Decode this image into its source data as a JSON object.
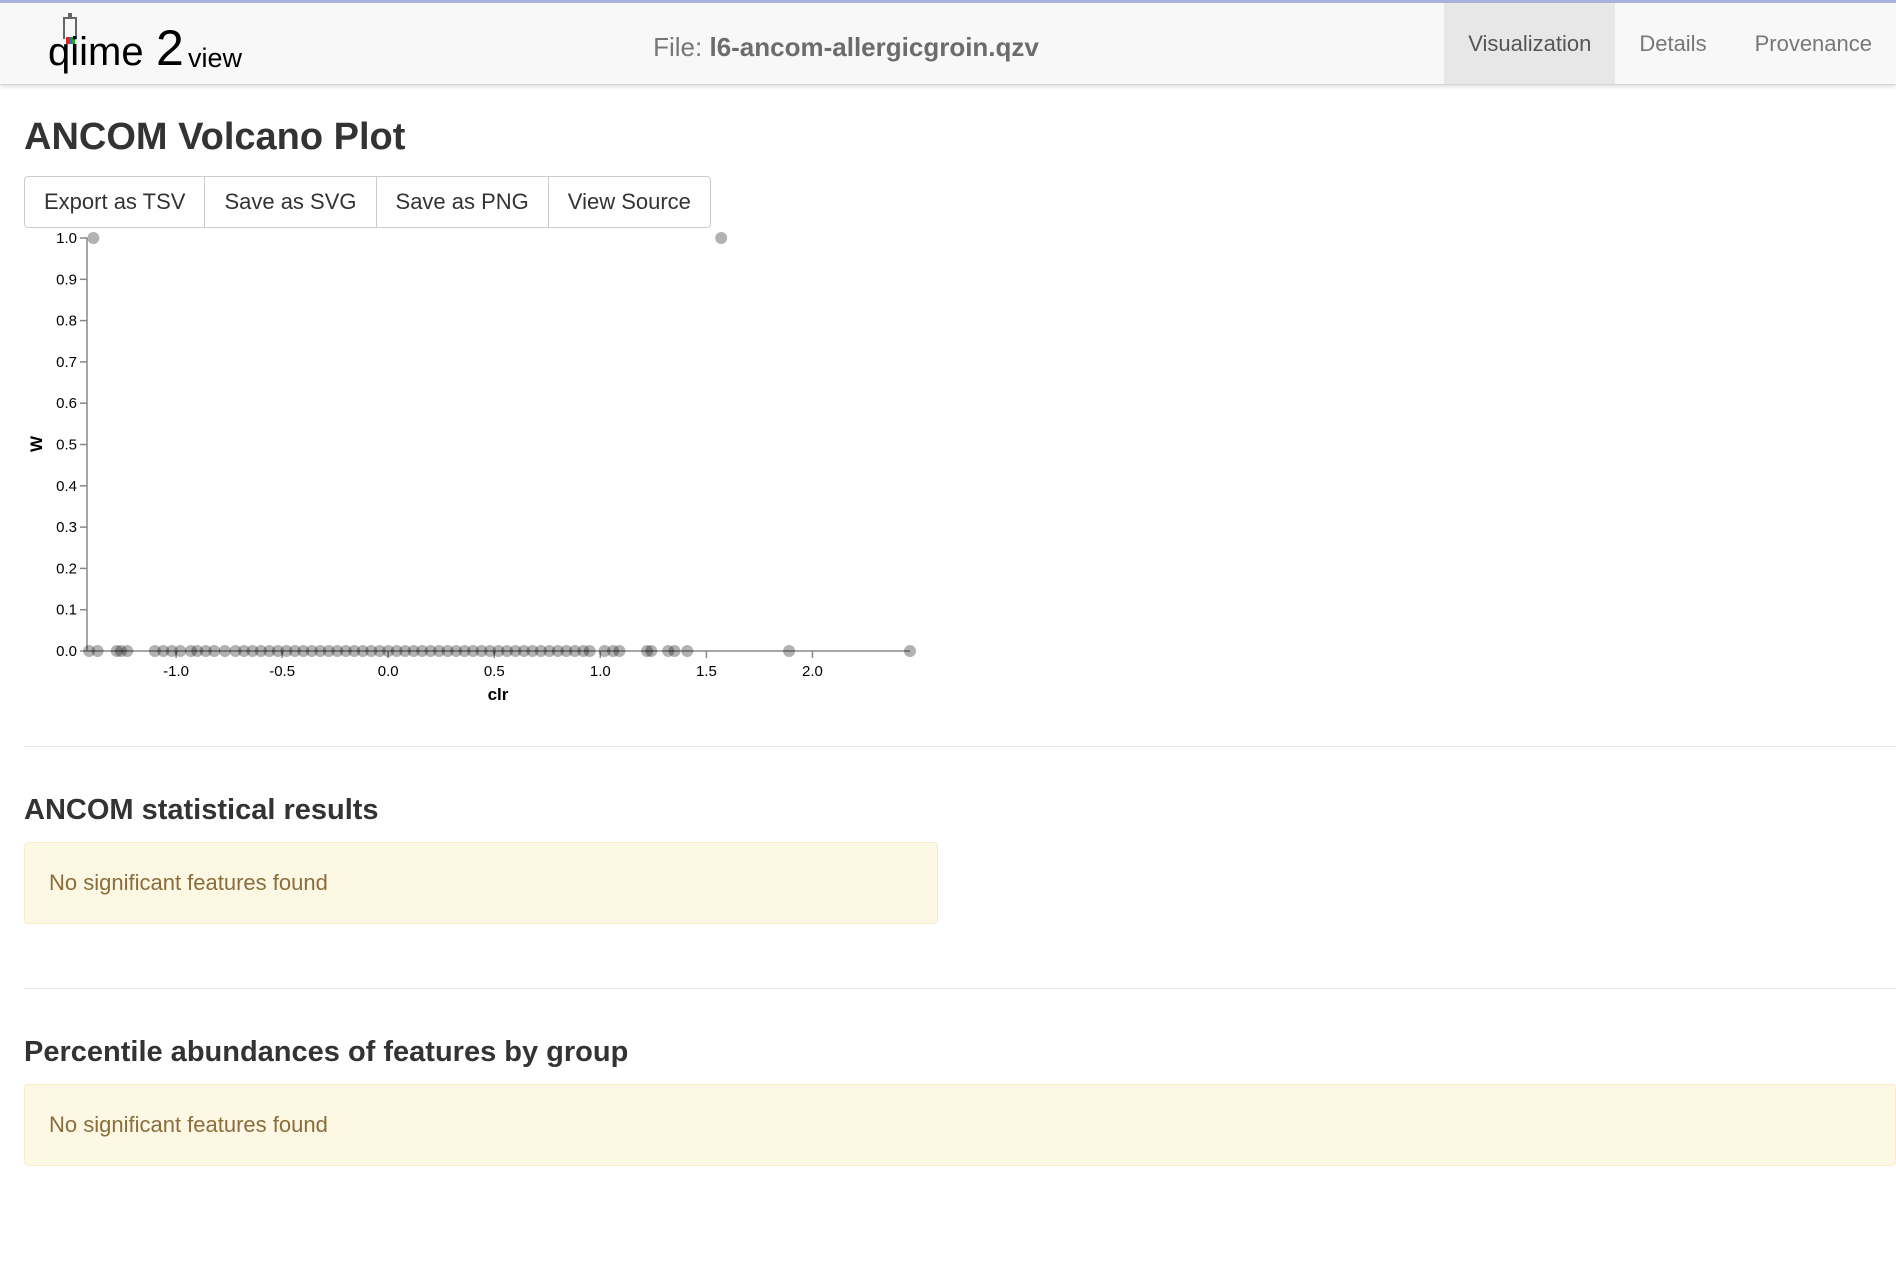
{
  "header": {
    "brand": "qiime2view",
    "file_prefix": "File:",
    "file_name": "l6-ancom-allergicgroin.qzv",
    "tabs": [
      {
        "label": "Visualization",
        "active": true
      },
      {
        "label": "Details",
        "active": false
      },
      {
        "label": "Provenance",
        "active": false
      }
    ]
  },
  "main": {
    "title": "ANCOM Volcano Plot",
    "buttons": [
      "Export as TSV",
      "Save as SVG",
      "Save as PNG",
      "View Source"
    ]
  },
  "chart_data": {
    "type": "scatter",
    "title": "",
    "xlabel": "clr",
    "ylabel": "W",
    "xlim": [
      -1.42,
      2.46
    ],
    "ylim": [
      0,
      1
    ],
    "xticks": [
      -1.0,
      -0.5,
      0.0,
      0.5,
      1.0,
      1.5,
      2.0
    ],
    "yticks": [
      0.0,
      0.1,
      0.2,
      0.3,
      0.4,
      0.5,
      0.6,
      0.7,
      0.8,
      0.9,
      1.0
    ],
    "point_color": "#000000",
    "point_opacity": 0.3,
    "grid": false,
    "points": [
      {
        "x": -1.39,
        "y": 1.0
      },
      {
        "x": 1.57,
        "y": 1.0
      },
      {
        "x": -1.41,
        "y": 0.0
      },
      {
        "x": -1.37,
        "y": 0.0
      },
      {
        "x": -1.28,
        "y": 0.0
      },
      {
        "x": -1.26,
        "y": 0.0
      },
      {
        "x": -1.23,
        "y": 0.0
      },
      {
        "x": -1.1,
        "y": 0.0
      },
      {
        "x": -1.06,
        "y": 0.0
      },
      {
        "x": -1.02,
        "y": 0.0
      },
      {
        "x": -0.98,
        "y": 0.0
      },
      {
        "x": -0.93,
        "y": 0.0
      },
      {
        "x": -0.9,
        "y": 0.0
      },
      {
        "x": -0.86,
        "y": 0.0
      },
      {
        "x": -0.82,
        "y": 0.0
      },
      {
        "x": -0.77,
        "y": 0.0
      },
      {
        "x": -0.72,
        "y": 0.0
      },
      {
        "x": -0.68,
        "y": 0.0
      },
      {
        "x": -0.64,
        "y": 0.0
      },
      {
        "x": -0.6,
        "y": 0.0
      },
      {
        "x": -0.56,
        "y": 0.0
      },
      {
        "x": -0.52,
        "y": 0.0
      },
      {
        "x": -0.48,
        "y": 0.0
      },
      {
        "x": -0.44,
        "y": 0.0
      },
      {
        "x": -0.4,
        "y": 0.0
      },
      {
        "x": -0.36,
        "y": 0.0
      },
      {
        "x": -0.32,
        "y": 0.0
      },
      {
        "x": -0.28,
        "y": 0.0
      },
      {
        "x": -0.24,
        "y": 0.0
      },
      {
        "x": -0.2,
        "y": 0.0
      },
      {
        "x": -0.16,
        "y": 0.0
      },
      {
        "x": -0.12,
        "y": 0.0
      },
      {
        "x": -0.08,
        "y": 0.0
      },
      {
        "x": -0.04,
        "y": 0.0
      },
      {
        "x": 0.0,
        "y": 0.0
      },
      {
        "x": 0.04,
        "y": 0.0
      },
      {
        "x": 0.08,
        "y": 0.0
      },
      {
        "x": 0.12,
        "y": 0.0
      },
      {
        "x": 0.16,
        "y": 0.0
      },
      {
        "x": 0.2,
        "y": 0.0
      },
      {
        "x": 0.24,
        "y": 0.0
      },
      {
        "x": 0.28,
        "y": 0.0
      },
      {
        "x": 0.32,
        "y": 0.0
      },
      {
        "x": 0.36,
        "y": 0.0
      },
      {
        "x": 0.4,
        "y": 0.0
      },
      {
        "x": 0.44,
        "y": 0.0
      },
      {
        "x": 0.48,
        "y": 0.0
      },
      {
        "x": 0.52,
        "y": 0.0
      },
      {
        "x": 0.56,
        "y": 0.0
      },
      {
        "x": 0.6,
        "y": 0.0
      },
      {
        "x": 0.64,
        "y": 0.0
      },
      {
        "x": 0.68,
        "y": 0.0
      },
      {
        "x": 0.72,
        "y": 0.0
      },
      {
        "x": 0.76,
        "y": 0.0
      },
      {
        "x": 0.8,
        "y": 0.0
      },
      {
        "x": 0.84,
        "y": 0.0
      },
      {
        "x": 0.88,
        "y": 0.0
      },
      {
        "x": 0.92,
        "y": 0.0
      },
      {
        "x": 0.95,
        "y": 0.0
      },
      {
        "x": 1.02,
        "y": 0.0
      },
      {
        "x": 1.06,
        "y": 0.0
      },
      {
        "x": 1.09,
        "y": 0.0
      },
      {
        "x": 1.22,
        "y": 0.0
      },
      {
        "x": 1.24,
        "y": 0.0
      },
      {
        "x": 1.32,
        "y": 0.0
      },
      {
        "x": 1.35,
        "y": 0.0
      },
      {
        "x": 1.41,
        "y": 0.0
      },
      {
        "x": 1.89,
        "y": 0.0
      },
      {
        "x": 2.46,
        "y": 0.0
      }
    ]
  },
  "sections": [
    {
      "title": "ANCOM statistical results",
      "message": "No significant features found"
    },
    {
      "title": "Percentile abundances of features by group",
      "message": "No significant features found"
    }
  ]
}
